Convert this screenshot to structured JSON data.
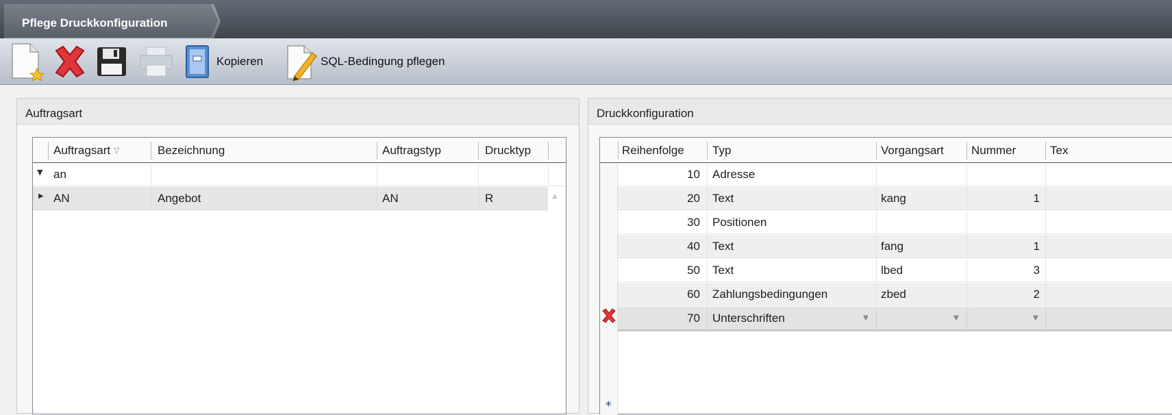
{
  "window": {
    "title": "Pflege Druckkonfiguration"
  },
  "toolbar": {
    "new_icon": "new-document-icon",
    "delete_icon": "delete-x-icon",
    "save_icon": "save-disk-icon",
    "print_icon": "printer-icon",
    "copy_label": "Kopieren",
    "sql_label": "SQL-Bedingung pflegen"
  },
  "left_panel": {
    "title": "Auftragsart",
    "columns": [
      "Auftragsart",
      "Bezeichnung",
      "Auftragstyp",
      "Drucktyp"
    ],
    "filter_value": "an",
    "rows": [
      {
        "auftragsart": "AN",
        "bezeichnung": "Angebot",
        "auftragstyp": "AN",
        "drucktyp": "R"
      }
    ]
  },
  "right_panel": {
    "title": "Druckkonfiguration",
    "columns": [
      "Reihenfolge",
      "Typ",
      "Vorgangsart",
      "Nummer",
      "Tex"
    ],
    "rows": [
      {
        "reihenfolge": "10",
        "typ": "Adresse",
        "vorgangsart": "",
        "nummer": ""
      },
      {
        "reihenfolge": "20",
        "typ": "Text",
        "vorgangsart": "kang",
        "nummer": "1"
      },
      {
        "reihenfolge": "30",
        "typ": "Positionen",
        "vorgangsart": "",
        "nummer": ""
      },
      {
        "reihenfolge": "40",
        "typ": "Text",
        "vorgangsart": "fang",
        "nummer": "1"
      },
      {
        "reihenfolge": "50",
        "typ": "Text",
        "vorgangsart": "lbed",
        "nummer": "3"
      },
      {
        "reihenfolge": "60",
        "typ": "Zahlungsbedingungen",
        "vorgangsart": "zbed",
        "nummer": "2"
      },
      {
        "reihenfolge": "70",
        "typ": "Unterschriften",
        "vorgangsart": "",
        "nummer": ""
      }
    ],
    "new_row_marker": "*"
  },
  "colors": {
    "accent_red": "#d9232b",
    "title_bg": "#4a5059",
    "selected_row": "#e6e6e6"
  }
}
